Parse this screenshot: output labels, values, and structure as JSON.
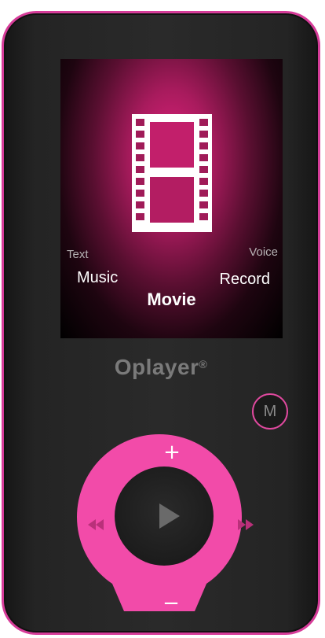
{
  "screen": {
    "menu": {
      "text_label": "Text",
      "voice_label": "Voice",
      "music_label": "Music",
      "record_label": "Record",
      "movie_label": "Movie"
    },
    "selected_icon": "film-strip-icon"
  },
  "brand": {
    "name": "Oplayer",
    "mark": "®"
  },
  "controls": {
    "mode_button_label": "M",
    "volume_up_glyph": "+",
    "volume_down_glyph": "−",
    "play_icon": "play-icon",
    "rewind_icon": "rewind-icon",
    "fast_forward_icon": "fast-forward-icon"
  },
  "colors": {
    "accent": "#f24ba9",
    "ring_border": "#e0499f",
    "device_body": "#262626",
    "screen_glow": "#e2227d"
  }
}
